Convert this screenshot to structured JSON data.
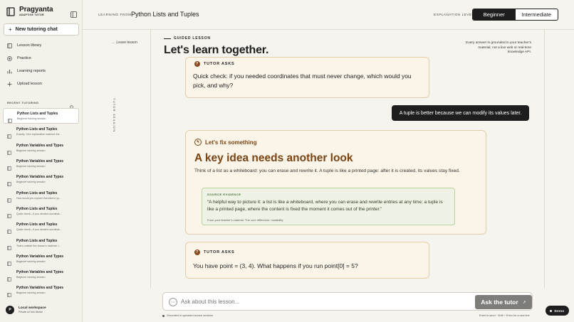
{
  "app": {
    "name": "Pragyanta",
    "tagline": "Adaptive Tutor",
    "new_chat": "New tutoring chat"
  },
  "nav": [
    {
      "label": "Lesson library",
      "icon": "book-icon"
    },
    {
      "label": "Practice",
      "icon": "target-icon"
    },
    {
      "label": "Learning reports",
      "icon": "chart-icon"
    },
    {
      "label": "Upload lesson",
      "icon": "plus-icon"
    }
  ],
  "recent": {
    "label": "Recent tutoring",
    "items": [
      {
        "title": "Python Lists and Tuples",
        "sub": "Beginner tutoring session",
        "active": true
      },
      {
        "title": "Python Lists and Tuples",
        "sub": "Exactly. Your explanation matches the..."
      },
      {
        "title": "Python Variables and Types",
        "sub": "Beginner tutoring session"
      },
      {
        "title": "Python Variables and Types",
        "sub": "Beginner tutoring session"
      },
      {
        "title": "Python Variables and Types",
        "sub": "Beginner tutoring session"
      },
      {
        "title": "Python Lists and Tuples",
        "sub": "How would you explain that idea in yo..."
      },
      {
        "title": "Python Lists and Tuples",
        "sub": "Quick check—if you needed coordinat..."
      },
      {
        "title": "Python Lists and Tuples",
        "sub": "Quick check—if you needed coordinat..."
      },
      {
        "title": "Python Lists and Tuples",
        "sub": "That's outside this lesson's material. I..."
      },
      {
        "title": "Python Variables and Types",
        "sub": "Beginner tutoring session"
      },
      {
        "title": "Python Variables and Types",
        "sub": "Beginner tutoring session"
      },
      {
        "title": "Python Variables and Types",
        "sub": "Beginner tutoring session"
      }
    ]
  },
  "workspace": {
    "avatar": "P",
    "title": "Local workspace",
    "sub": "Private on this device"
  },
  "header": {
    "learning_from": "Learning from",
    "title": "Python Lists and Tuples",
    "explanation_level": "Explanation level",
    "levels": [
      "Beginner",
      "Intermediate"
    ],
    "selected_level": "Beginner"
  },
  "rail": {
    "leave": "← Leave lesson",
    "vertical": "Tutor session"
  },
  "lesson": {
    "eyebrow": "Guided lesson",
    "title": "Let's learn together.",
    "grounded_note": "Every answer is grounded in your teacher's material, not a live web or real-time knowledge API."
  },
  "messages": {
    "tutor1": {
      "label": "Tutor asks",
      "text": "Quick check: if you needed coordinates that must never change, which would you pick, and why?"
    },
    "user": "A tuple is better because we can modify its values later.",
    "fix": {
      "label": "Let's fix something",
      "title": "A key idea needs another look",
      "body": "Think of a list as a whiteboard: you can erase and rewrite it. A tuple is like a printed page: after it is created, its values stay fixed.",
      "evidence_label": "Source evidence",
      "evidence_quote": "“A helpful way to picture it: a list is like a whiteboard, where you can erase and rewrite entries at any time; a tuple is like a printed page, where the content is fixed the moment it comes out of the printer.”",
      "evidence_source": "From your teacher's material: The core difference: mutability"
    },
    "tutor2": {
      "label": "Tutor asks",
      "text": "You have point = (3, 4). What happens if you run point[0] = 5?"
    }
  },
  "composer": {
    "placeholder": "Ask about this lesson...",
    "ask": "Ask the tutor",
    "grounded": "Grounded in uploaded source sections",
    "hint": "Enter to send · Shift + Enter for a new line"
  },
  "demo": "Demo",
  "colors": {
    "accent": "#7a4414",
    "dark": "#1e1e1e",
    "evidence": "#3f6a24"
  }
}
